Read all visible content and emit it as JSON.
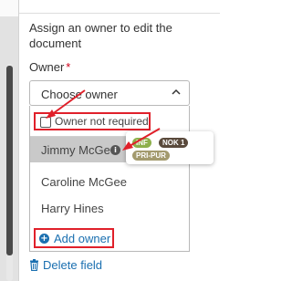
{
  "panel": {
    "help_text": "Assign an owner to edit the document",
    "owner_label": "Owner",
    "required_mark": "*"
  },
  "owner_select": {
    "placeholder": "Choose owner",
    "expanded": true
  },
  "dropdown": {
    "owner_not_required": {
      "label": "Owner not required",
      "checked": false
    },
    "options": [
      {
        "label": "Jimmy McGee",
        "highlighted": true,
        "has_info": true
      },
      {
        "label": "Caroline McGee",
        "highlighted": false
      },
      {
        "label": "Harry Hines",
        "highlighted": false
      }
    ],
    "add_owner_label": "Add owner"
  },
  "tooltip": {
    "tags": [
      {
        "label": "INF",
        "color": "#8db04c"
      },
      {
        "label": "NOK 1",
        "color": "#5a4a3c"
      },
      {
        "label": "PRI-PUR",
        "color": "#a39a6e"
      }
    ]
  },
  "delete_field_label": "Delete field",
  "colors": {
    "link": "#1a6fb0",
    "annotation_red": "#e0202a",
    "highlight_row": "#c9c9c9"
  }
}
